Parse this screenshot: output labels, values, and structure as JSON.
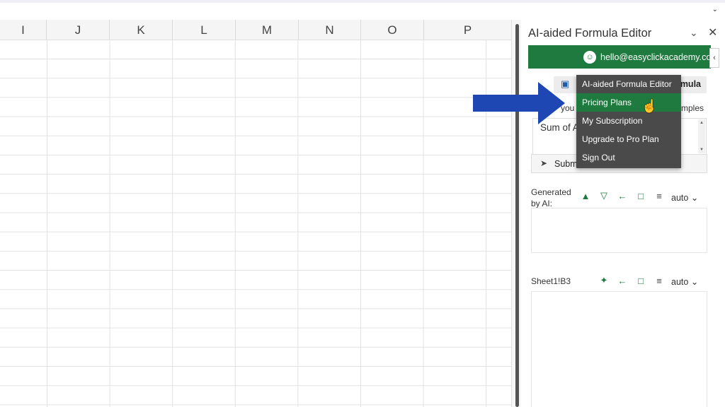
{
  "sheet": {
    "columns": [
      "I",
      "J",
      "K",
      "L",
      "M",
      "N",
      "O",
      "P"
    ]
  },
  "pane": {
    "title": "AI-aided Formula Editor",
    "account_email": "hello@easyclickacademy.com",
    "build_button_label": "mula",
    "description_partial": "you",
    "examples_label": "mples",
    "prompt_text": "Sum of A",
    "submit_label": "Subm",
    "generated_label": "Generated by AI:",
    "generated_auto": "auto",
    "cell_ref": "Sheet1!B3",
    "cell_auto": "auto"
  },
  "account_menu": {
    "items": [
      {
        "label": "AI-aided Formula Editor",
        "active": false
      },
      {
        "label": "Pricing Plans",
        "active": true
      },
      {
        "label": "My Subscription",
        "active": false
      },
      {
        "label": "Upgrade to Pro Plan",
        "active": false
      },
      {
        "label": "Sign Out",
        "active": false
      }
    ]
  },
  "colors": {
    "brand_green": "#1e7a3e",
    "arrow_blue": "#1e47b4",
    "menu_bg": "#4a4a4a"
  }
}
